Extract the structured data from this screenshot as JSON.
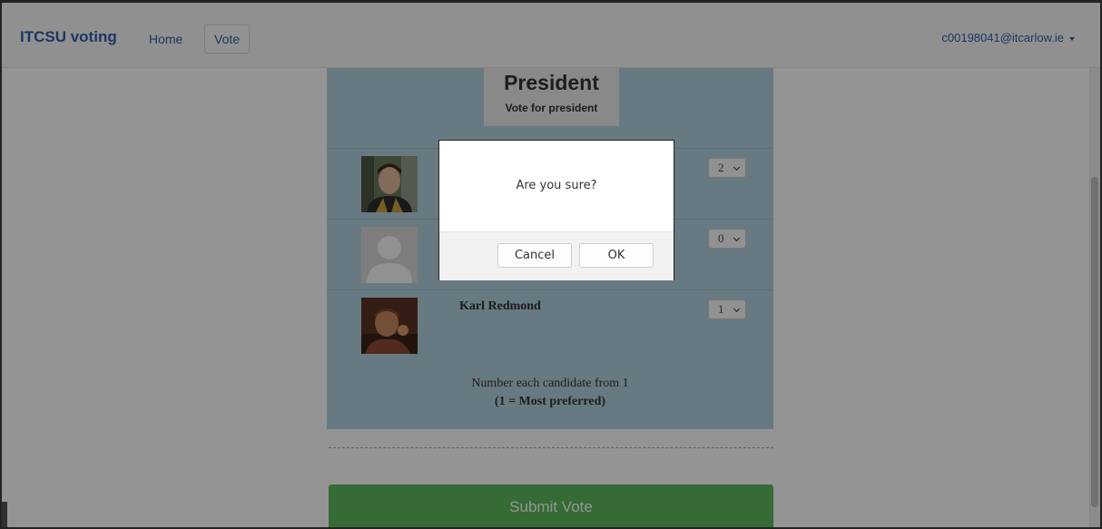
{
  "navbar": {
    "brand": "ITCSU voting",
    "links": [
      {
        "label": "Home",
        "active": false
      },
      {
        "label": "Vote",
        "active": true
      }
    ],
    "user": "c00198041@itcarlow.ie"
  },
  "ballot": {
    "title": "President",
    "subtitle": "Vote for president",
    "candidates": [
      {
        "name": "",
        "rank": "2",
        "photo": "candidate-photo"
      },
      {
        "name": "",
        "rank": "0",
        "photo": "default-avatar"
      },
      {
        "name": "Karl Redmond",
        "rank": "1",
        "photo": "candidate-photo"
      }
    ],
    "instructions": {
      "line1": "Number each candidate from 1",
      "line2": "(1 = Most preferred)"
    }
  },
  "submit_label": "Submit Vote",
  "dialog": {
    "message": "Are you sure?",
    "cancel_label": "Cancel",
    "ok_label": "OK"
  },
  "colors": {
    "brand": "#2c5fa8",
    "panel": "#b4d3df",
    "submit": "#5cb85c",
    "overlay": "rgba(0,0,0,0.42)"
  }
}
